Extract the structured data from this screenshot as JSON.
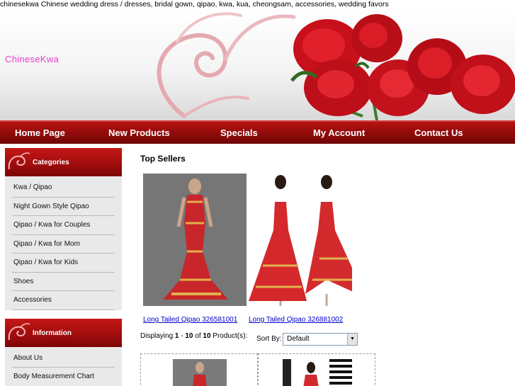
{
  "header": {
    "title_line": "chinesekwa Chinese wedding dress / dresses, bridal gown, qipao, kwa, kua, cheongsam, accessories, wedding favors",
    "brand": "ChineseKwa"
  },
  "nav": {
    "items": [
      {
        "label": "Home Page"
      },
      {
        "label": "New Products"
      },
      {
        "label": "Specials"
      },
      {
        "label": "My Account"
      },
      {
        "label": "Contact Us"
      }
    ]
  },
  "sidebar": {
    "categories_title": "Categories",
    "categories": [
      {
        "label": "Kwa / Qipao"
      },
      {
        "label": "Night Gown Style Qipao"
      },
      {
        "label": "Qipao / Kwa for Couples"
      },
      {
        "label": "Qipao / Kwa for Mom"
      },
      {
        "label": "Qipao / Kwa for Kids"
      },
      {
        "label": "Shoes"
      },
      {
        "label": "Accessories"
      }
    ],
    "information_title": "Information",
    "information": [
      {
        "label": "About Us"
      },
      {
        "label": "Body Measurement Chart"
      }
    ]
  },
  "main": {
    "section_title": "Top Sellers",
    "products": [
      {
        "name": "Long Tailed Qipao 326581001"
      },
      {
        "name": "Long Tailed Qipao 326881002"
      }
    ],
    "listing": {
      "prefix": "Displaying ",
      "from": "1",
      "sep1": " - ",
      "to": "10",
      "sep2": " of ",
      "total": "10",
      "suffix": " Product(s):"
    },
    "sort": {
      "label": "Sort By:",
      "selected": "Default"
    }
  },
  "colors": {
    "brand_pink": "#e63ccf",
    "nav_red": "#8f0a0a",
    "link_blue": "#0000cc"
  }
}
